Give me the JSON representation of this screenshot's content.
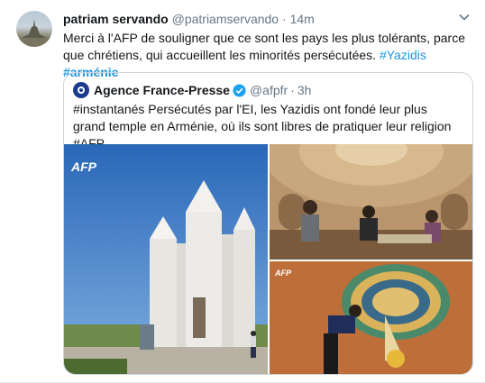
{
  "tweet": {
    "author_name": "patriam servando",
    "author_handle": "@patriamservando",
    "separator": "·",
    "time": "14m",
    "text_main": "Merci à l'AFP de souligner que ce sont les pays les plus tolérants, parce que chrétiens, qui accueillent les minorités  persécutées. ",
    "hashtag1": "#Yazidis",
    "hashtag2": "#arménie"
  },
  "quote": {
    "author_name": "Agence France-Presse",
    "author_handle": "@afpfr",
    "separator": "·",
    "time": "3h",
    "text": "#instantanés Persécutés par l'EI, les Yazidis ont fondé leur plus grand temple en Arménie, où ils sont libres de pratiquer leur religion #AFP"
  },
  "media": {
    "logo_text": "AFP"
  },
  "colors": {
    "link": "#1b95e0",
    "secondary": "#657786",
    "border": "#ccd6dd",
    "verified": "#1da1f2"
  }
}
